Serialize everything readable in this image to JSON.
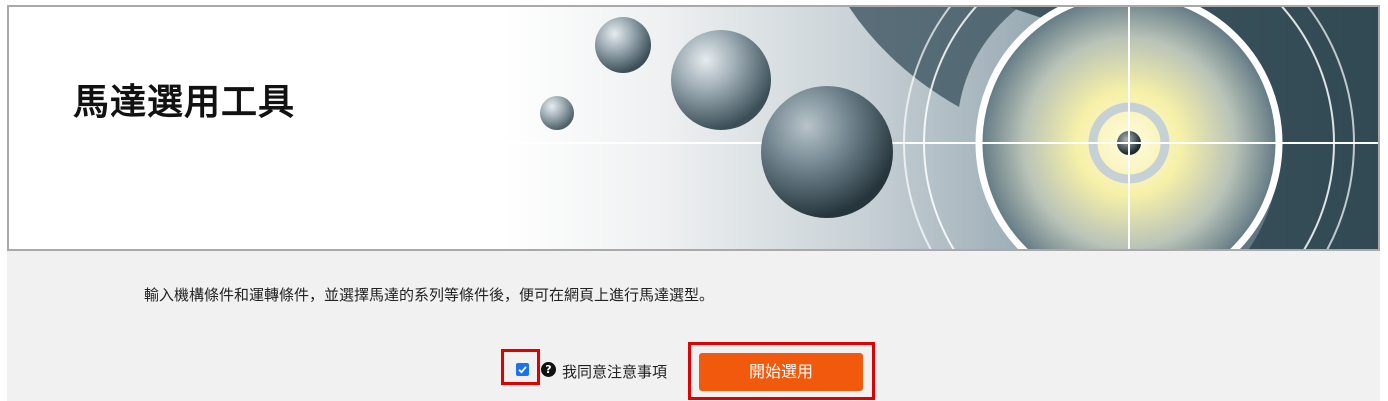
{
  "banner": {
    "title": "馬達選用工具"
  },
  "main": {
    "intro_text": "輸入機構條件和運轉條件，並選擇馬達的系列等條件後，便可在網頁上進行馬達選型。",
    "agree": {
      "checked": true,
      "help_icon_glyph": "?",
      "label": "我同意注意事項"
    },
    "start_button_label": "開始選用"
  },
  "colors": {
    "button": "#f15a0c",
    "highlight": "#e00000",
    "checkbox": "#1a73e8",
    "content_bg": "#f1f1f1"
  }
}
